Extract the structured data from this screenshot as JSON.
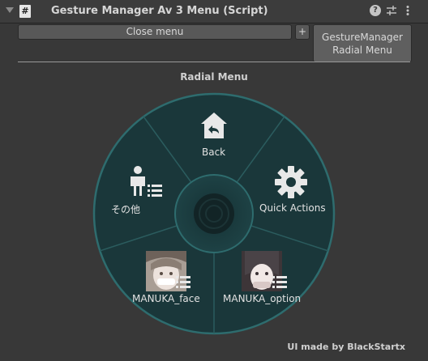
{
  "header": {
    "title": "Gesture Manager Av 3 Menu (Script)",
    "icons": [
      "foldout-arrow",
      "script-icon",
      "help-icon",
      "presets-icon",
      "kebab-menu-icon"
    ]
  },
  "toolbar": {
    "close_menu_label": "Close menu",
    "plus_label": "+",
    "tab_line1": "GestureManager",
    "tab_line2": "Radial Menu"
  },
  "radial": {
    "title": "Radial Menu",
    "items": [
      {
        "label": "Back",
        "icon": "home-back-icon"
      },
      {
        "label": "Quick Actions",
        "icon": "gear-icon"
      },
      {
        "label": "MANUKA_option",
        "icon": "avatar-thumbnail-icon"
      },
      {
        "label": "MANUKA_face",
        "icon": "avatar-thumbnail-icon"
      },
      {
        "label": "その他",
        "icon": "person-icon"
      }
    ],
    "colors": {
      "fill": "#1c3a3d",
      "rim": "#2d6a6c",
      "center": "#1f4446"
    }
  },
  "footer": {
    "credit": "UI made by BlackStartx"
  }
}
